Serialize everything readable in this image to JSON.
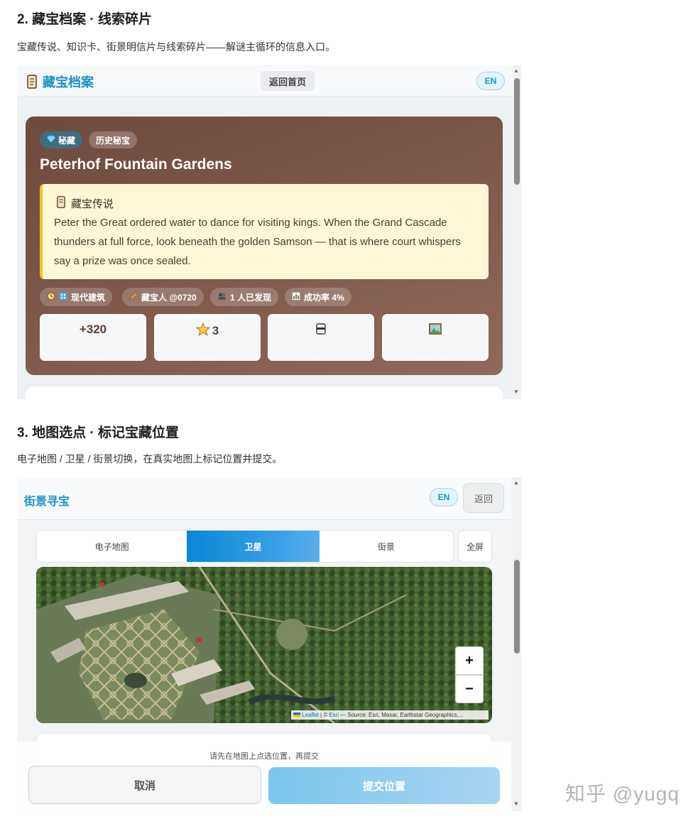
{
  "section2": {
    "title": "2. 藏宝档案 · 线索碎片",
    "desc": "宝藏传说、知识卡、街景明信片与线索碎片——解谜主循环的信息入口。"
  },
  "archive": {
    "app_title": "藏宝档案",
    "home_button": "返回首页",
    "lang_button": "EN",
    "badge_secret": "秘藏",
    "badge_category": "历史秘宝",
    "place_name": "Peterhof Fountain Gardens",
    "legend_heading": "藏宝传说",
    "legend_text": "Peter the Great ordered water to dance for visiting kings. When the Grand Cascade thunders at full force, look beneath the golden Samson — that is where court whispers say a prize was once sealed.",
    "stats": {
      "architecture": "现代建筑",
      "hider": "藏宝人 @0720",
      "found": "1 人已发现",
      "success_rate": "成功率 4%"
    },
    "tiles": [
      {
        "value": "+320",
        "label": "寻宝值",
        "icon": ""
      },
      {
        "value": "3",
        "label": "难度",
        "icon": "star-icon"
      },
      {
        "value": "",
        "label": "知识卡",
        "icon": "card-icon"
      },
      {
        "value": "",
        "label": "街景明信片",
        "icon": "picture-icon"
      }
    ]
  },
  "section3": {
    "title": "3. 地图选点 · 标记宝藏位置",
    "desc": "电子地图 / 卫星 / 街景切换，在真实地图上标记位置并提交。"
  },
  "mapview": {
    "app_title": "街景寻宝",
    "lang_button": "EN",
    "back_button": "返回",
    "tabs": [
      "电子地图",
      "卫星",
      "街景"
    ],
    "active_tab": "卫星",
    "fullscreen_button": "全屏",
    "zoom_in": "+",
    "zoom_out": "−",
    "attribution_leaflet": "Leaflet",
    "attribution_sep": "| ©",
    "attribution_esri": "Esri",
    "attribution_source": "— Source: Esri, Maxar, Earthstar Geographics,...",
    "hint": "请先在地图上点选位置，再提交",
    "cancel_button": "取消",
    "submit_button": "提交位置"
  },
  "watermark": "知乎 @yugq",
  "colors": {
    "accent": "#1a93c8",
    "card_brown": "#7a5448",
    "legend_bg": "#fdf6d8",
    "legend_bar": "#f2c417",
    "tab_active": "#0a87d6",
    "submit": "#8ccbef"
  }
}
